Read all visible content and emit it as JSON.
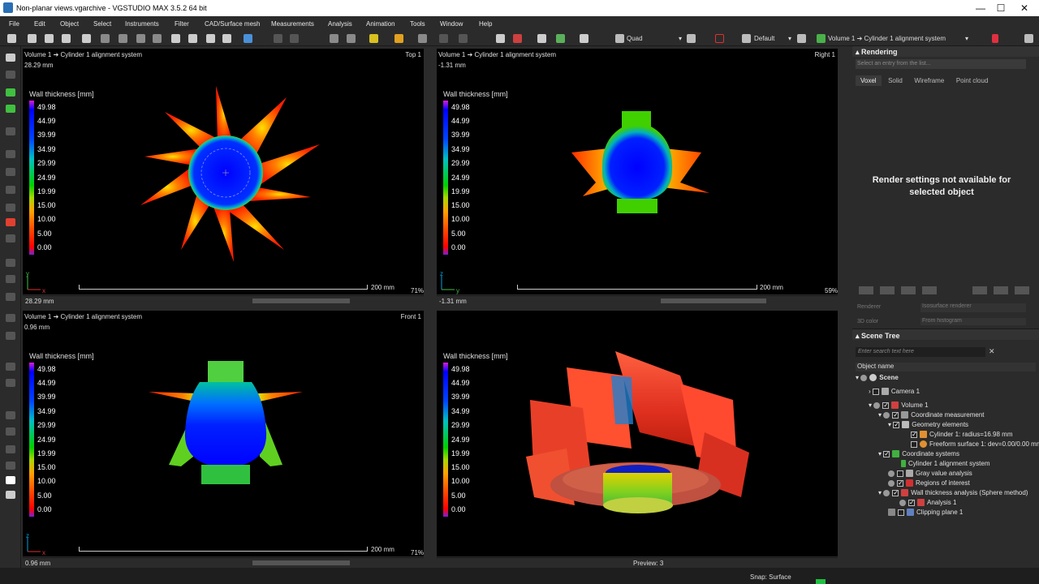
{
  "window": {
    "title": "Non-planar views.vgarchive - VGSTUDIO MAX 3.5.2 64 bit",
    "minimize": "—",
    "maximize": "☐",
    "close": "✕"
  },
  "menu": [
    "File",
    "Edit",
    "Object",
    "Select",
    "Instruments",
    "Filter",
    "CAD/Surface mesh",
    "Measurements",
    "Analysis",
    "Animation",
    "Tools",
    "Window",
    "Help"
  ],
  "toolbar": {
    "layout": "Quad",
    "preset": "Default",
    "alignment": "Volume 1 ➔ Cylinder 1 alignment system"
  },
  "legend": {
    "title": "Wall thickness [mm]",
    "ticks": [
      "49.98",
      "44.99",
      "39.99",
      "34.99",
      "29.99",
      "24.99",
      "19.99",
      "15.00",
      "10.00",
      "5.00",
      "0.00"
    ]
  },
  "viewports": {
    "top": {
      "path": "Volume 1 ➔ Cylinder 1 alignment system",
      "depth": "28.29 mm",
      "label": "Top 1",
      "axis_v": "y",
      "axis_h": "x",
      "scale": "200 mm",
      "zoom": "71%",
      "pos": "28.29 mm"
    },
    "right": {
      "path": "Volume 1 ➔ Cylinder 1 alignment system",
      "depth": "-1.31 mm",
      "label": "Right 1",
      "axis_v": "z",
      "axis_h": "y",
      "scale": "200 mm",
      "zoom": "59%",
      "pos": "-1.31 mm"
    },
    "front": {
      "path": "Volume 1 ➔ Cylinder 1 alignment system",
      "depth": "0.96 mm",
      "label": "Front 1",
      "axis_v": "z",
      "axis_h": "x",
      "scale": "200 mm",
      "zoom": "71%",
      "pos": "0.96 mm"
    },
    "threed": {
      "preview": "Preview: 3"
    }
  },
  "rendering": {
    "title": "Rendering",
    "placeholder": "Select an entry from the list...",
    "tabs": [
      "Voxel",
      "Solid",
      "Wireframe",
      "Point cloud"
    ],
    "message": "Render settings not available for selected object",
    "renderer_label": "Renderer",
    "renderer_value": "Isosurface renderer",
    "color_label": "3D color",
    "color_value": "From histogram"
  },
  "scene_tree": {
    "title": "Scene Tree",
    "search_placeholder": "Enter search text here",
    "column": "Object name",
    "items": [
      {
        "label": "Scene",
        "level": 0
      },
      {
        "label": "Camera 1",
        "level": 1
      },
      {
        "label": "Volume 1",
        "level": 1
      },
      {
        "label": "Coordinate measurement",
        "level": 2
      },
      {
        "label": "Geometry elements",
        "level": 3
      },
      {
        "label": "Cylinder 1: radius=16.98 mm",
        "level": 4
      },
      {
        "label": "Freeform surface 1: dev=0.00/0.00 mm",
        "level": 4
      },
      {
        "label": "Coordinate systems",
        "level": 2
      },
      {
        "label": "Cylinder 1 alignment system",
        "level": 3
      },
      {
        "label": "Gray value analysis",
        "level": 2
      },
      {
        "label": "Regions of interest",
        "level": 2
      },
      {
        "label": "Wall thickness analysis (Sphere method)",
        "level": 2
      },
      {
        "label": "Analysis 1",
        "level": 3
      },
      {
        "label": "Clipping plane 1",
        "level": 2
      }
    ]
  },
  "status": {
    "snap": "Snap: Surface"
  }
}
